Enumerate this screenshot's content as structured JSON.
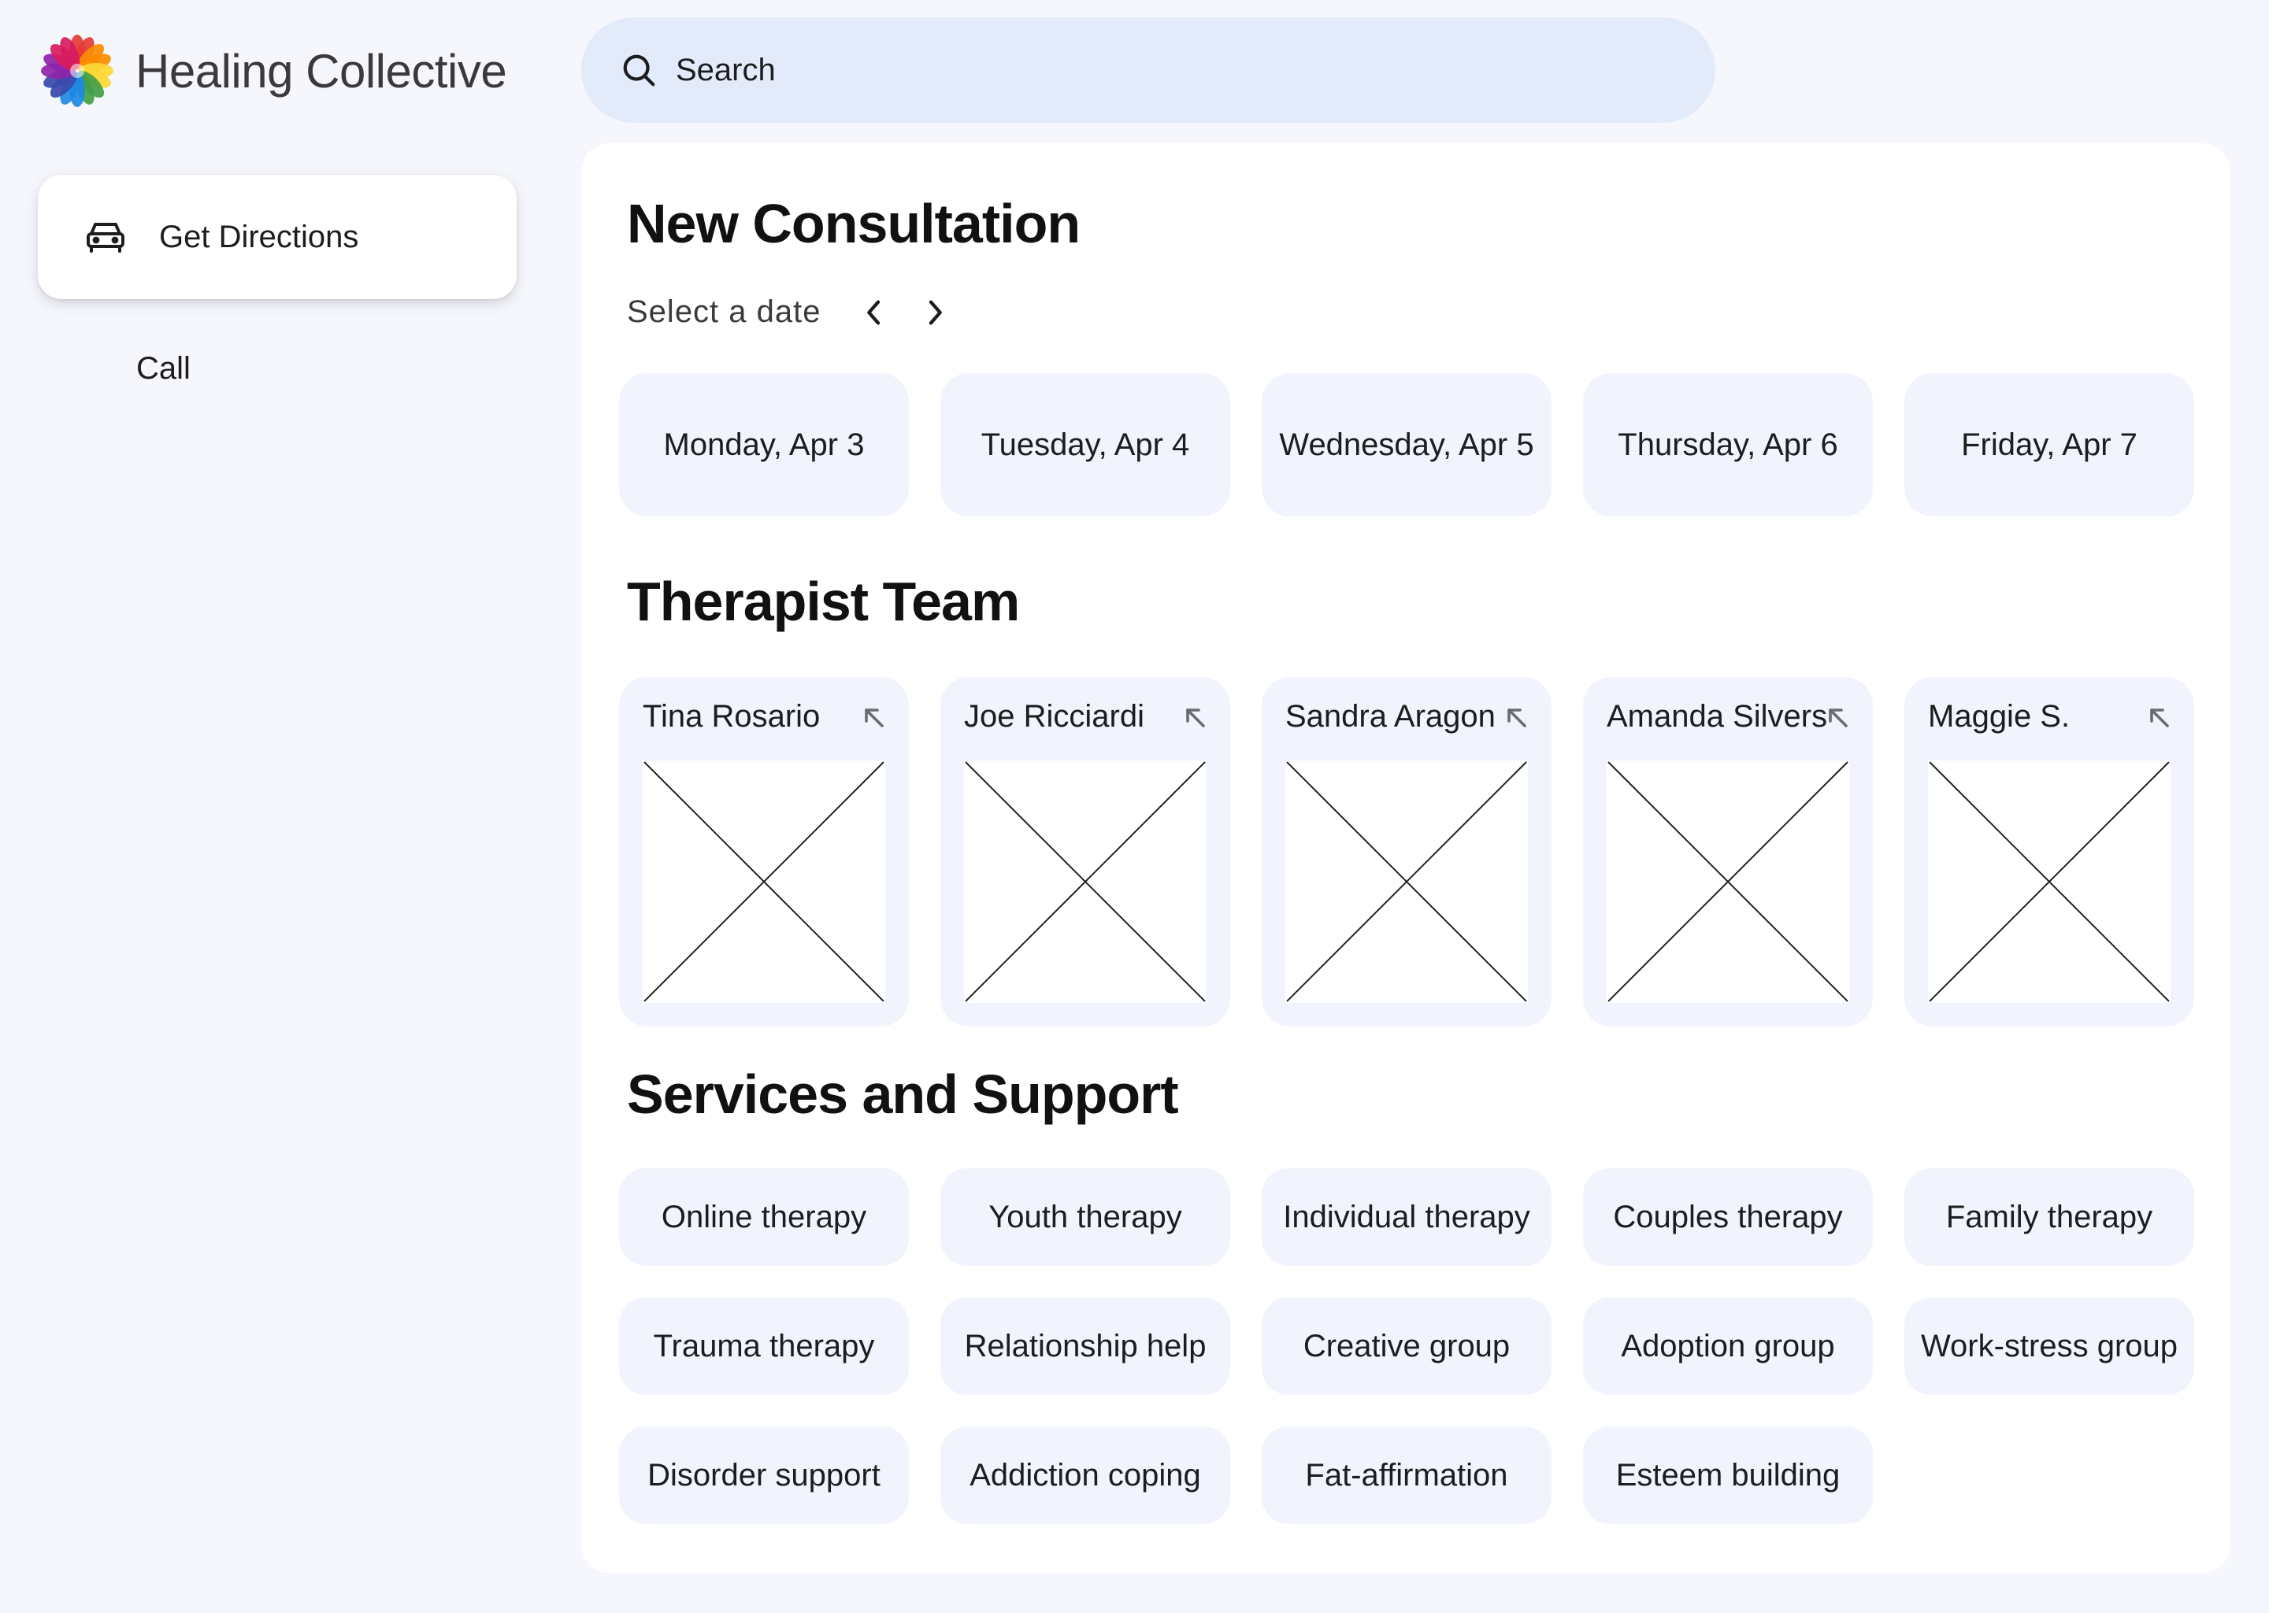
{
  "brand": {
    "name": "Healing Collective",
    "logo_icon": "rainbow-flower-logo",
    "logo_colors": [
      "#e53935",
      "#fb8c00",
      "#fdd835",
      "#43a047",
      "#1e88e5",
      "#3949ab",
      "#8e24aa",
      "#d81b60"
    ]
  },
  "search": {
    "placeholder": "Search",
    "icon": "search-icon"
  },
  "sidebar": {
    "primary_action": {
      "label": "Get Directions",
      "icon": "car-icon"
    },
    "secondary_action": {
      "label": "Call"
    }
  },
  "consultation": {
    "title": "New Consultation",
    "date_label": "Select a date",
    "prev_icon": "chevron-left-icon",
    "next_icon": "chevron-right-icon",
    "dates": [
      "Monday, Apr 3",
      "Tuesday, Apr 4",
      "Wednesday, Apr 5",
      "Thursday, Apr 6",
      "Friday, Apr 7"
    ]
  },
  "team": {
    "title": "Therapist Team",
    "expand_icon": "arrow-up-left-icon",
    "members": [
      "Tina Rosario",
      "Joe Ricciardi",
      "Sandra Aragon",
      "Amanda Silvers",
      "Maggie S."
    ]
  },
  "services": {
    "title": "Services and Support",
    "rows": [
      [
        "Online therapy",
        "Youth therapy",
        "Individual therapy",
        "Couples therapy",
        "Family therapy"
      ],
      [
        "Trauma therapy",
        "Relationship help",
        "Creative group",
        "Adoption group",
        "Work-stress group"
      ],
      [
        "Disorder support",
        "Addiction coping",
        "Fat-affirmation",
        "Esteem building"
      ]
    ]
  },
  "colors": {
    "page_background": "#f5f7fd",
    "search_background": "#e3ebfb",
    "tile_background": "#f1f4fc",
    "panel_background": "#ffffff"
  }
}
